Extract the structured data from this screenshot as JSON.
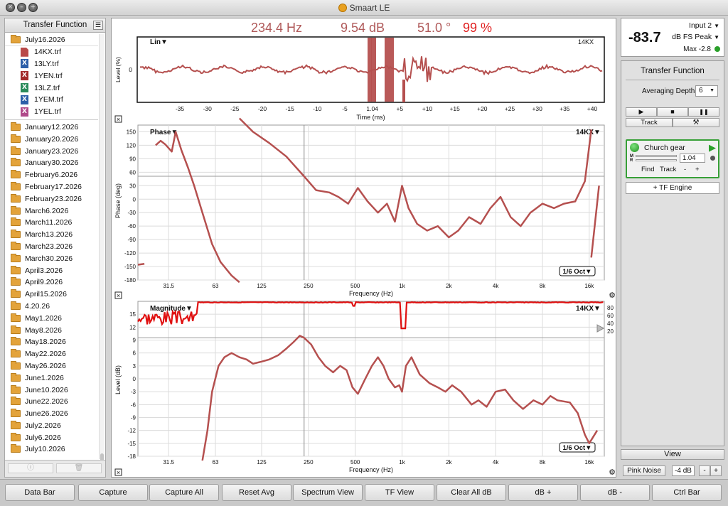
{
  "app": {
    "title": "Smaart LE"
  },
  "sidebar": {
    "header": "Transfer Function",
    "menu_icon": "list-icon",
    "open_folder": "July16.2026",
    "files": [
      {
        "name": "14KX.trf",
        "icon": "doc",
        "color": "#b94a4a"
      },
      {
        "name": "13LY.trf",
        "icon": "x",
        "color": "#2c5fa8"
      },
      {
        "name": "1YEN.trf",
        "icon": "x",
        "color": "#a22a2a"
      },
      {
        "name": "13LZ.trf",
        "icon": "x",
        "color": "#2a8a5a"
      },
      {
        "name": "1YEM.trf",
        "icon": "x",
        "color": "#2c5fa8"
      },
      {
        "name": "1YEL.trf",
        "icon": "x",
        "color": "#b04a8a"
      }
    ],
    "folders": [
      "January12.2026",
      "January20.2026",
      "January23.2026",
      "January30.2026",
      "February6.2026",
      "February17.2026",
      "February23.2026",
      "March6.2026",
      "March11.2026",
      "March13.2026",
      "March23.2026",
      "March30.2026",
      "April3.2026",
      "April9.2026",
      "April15.2026",
      "4.20.26",
      "May1.2026",
      "May8.2026",
      "May18.2026",
      "May22.2026",
      "May26.2026",
      "June1.2026",
      "June10.2026",
      "June22.2026",
      "June26.2026",
      "July2.2026",
      "July6.2026",
      "July10.2026"
    ]
  },
  "readouts": {
    "freq": "234.4 Hz",
    "level": "9.54 dB",
    "phase": "51.0 °",
    "coherence": "99 %"
  },
  "impulse": {
    "mode": "Lin▼",
    "trace": "14KX",
    "ylabel": "Level (%)",
    "y0": "0",
    "xlabel": "Time (ms)",
    "ticks": [
      "-35",
      "-30",
      "-25",
      "-20",
      "-15",
      "-10",
      "-5",
      "1.04",
      "+5",
      "+10",
      "+15",
      "+20",
      "+25",
      "+30",
      "+35",
      "+40"
    ]
  },
  "phase": {
    "title": "Phase▼",
    "trace": "14KX▼",
    "ylabel": "Phase (deg)",
    "xlabel": "Frequency (Hz)",
    "smoothing": "1/6 Oct▼",
    "yticks": [
      "150",
      "120",
      "90",
      "60",
      "30",
      "0",
      "-30",
      "-60",
      "-90",
      "-120",
      "-150",
      "-180"
    ],
    "xticks": [
      "31.5",
      "63",
      "125",
      "250",
      "500",
      "1k",
      "2k",
      "4k",
      "8k",
      "16k"
    ]
  },
  "magnitude": {
    "title": "Magnitude▼",
    "trace": "14KX▼",
    "ylabel": "Level (dB)",
    "xlabel": "Frequency (Hz)",
    "smoothing": "1/6 Oct▼",
    "yticks": [
      "15",
      "12",
      "9",
      "6",
      "3",
      "0",
      "-3",
      "-6",
      "-9",
      "-12",
      "-15",
      "-18"
    ],
    "xticks": [
      "31.5",
      "63",
      "125",
      "250",
      "500",
      "1k",
      "2k",
      "4k",
      "8k",
      "16k"
    ],
    "coh_ticks": [
      "80",
      "60",
      "40",
      "20"
    ]
  },
  "meter": {
    "value": "-83.7",
    "input": "Input 2",
    "unit": "dB FS Peak",
    "max": "Max -2.8"
  },
  "tf_panel": {
    "title": "Transfer Function",
    "avg_label": "Averaging Depth:",
    "avg_value": "6",
    "play": "▶",
    "stop": "■",
    "pause": "❚❚",
    "track": "Track",
    "tools": "⚒",
    "engine_name": "Church gear",
    "m_label": "M",
    "r_label": "R",
    "delay_value": "1.04",
    "find": "Find",
    "track2": "Track",
    "minus": "-",
    "plus": "+",
    "add_engine": "+ TF Engine"
  },
  "view": {
    "label": "View",
    "pink_noise": "Pink Noise",
    "level": "-4 dB",
    "minus": "-",
    "plus": "+"
  },
  "bottom_buttons": [
    "Data Bar",
    "Capture",
    "Capture All",
    "Reset Avg",
    "Spectrum View",
    "TF View",
    "Clear All dB",
    "dB +",
    "dB -",
    "Ctrl Bar"
  ],
  "colors": {
    "trace": "#b5504f",
    "coherence": "#e01010",
    "accent_green": "#2aa02a"
  }
}
